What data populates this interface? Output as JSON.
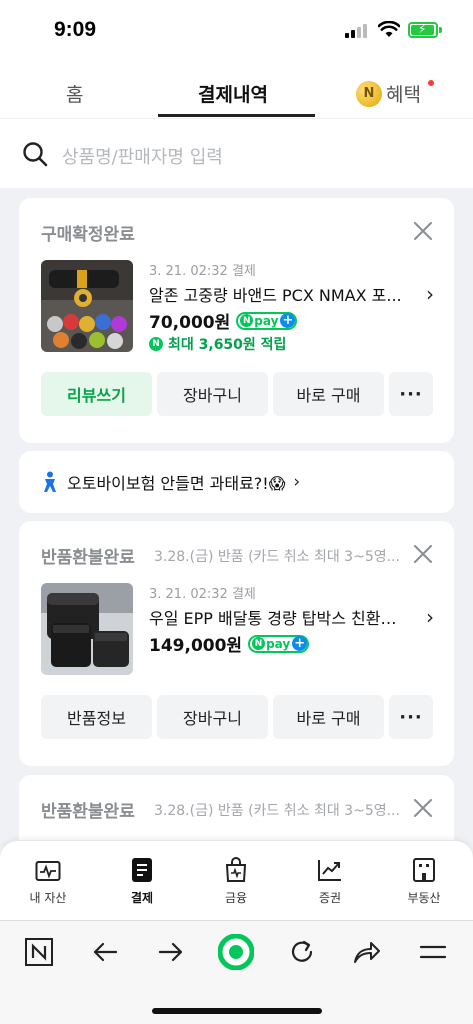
{
  "status_bar": {
    "time": "9:09"
  },
  "tabs": {
    "home": "홈",
    "payments": "결제내역",
    "benefits": "혜택"
  },
  "search": {
    "placeholder": "상품명/판매자명 입력"
  },
  "orders": [
    {
      "status": "구매확정완료",
      "status_sub": "",
      "date": "3. 21. 02:32 결제",
      "name": "알존 고중량 바앤드 PCX NMAX 포...",
      "price": "70,000원",
      "reward": "최대 3,650원 적립",
      "buttons": [
        "리뷰쓰기",
        "장바구니",
        "바로 구매"
      ]
    },
    {
      "status": "반품환불완료",
      "status_sub": "3.28.(금) 반품 (카드 취소 최대 3~5영...",
      "date": "3. 21. 02:32 결제",
      "name": "우일 EPP 배달통 경량 탑박스 친환경 ...",
      "price": "149,000원",
      "buttons": [
        "반품정보",
        "장바구니",
        "바로 구매"
      ]
    },
    {
      "status": "반품환불완료",
      "status_sub": "3.28.(금) 반품 (카드 취소 최대 3~5영..."
    }
  ],
  "banner": {
    "text": "오토바이보험 안들면 과태료?!😱"
  },
  "npay_label": "pay",
  "bottom_nav": [
    "내 자산",
    "결제",
    "금융",
    "증권",
    "부동산"
  ],
  "colors": {
    "accent_green": "#03c75a",
    "npay_blue": "#0d8cf0"
  }
}
